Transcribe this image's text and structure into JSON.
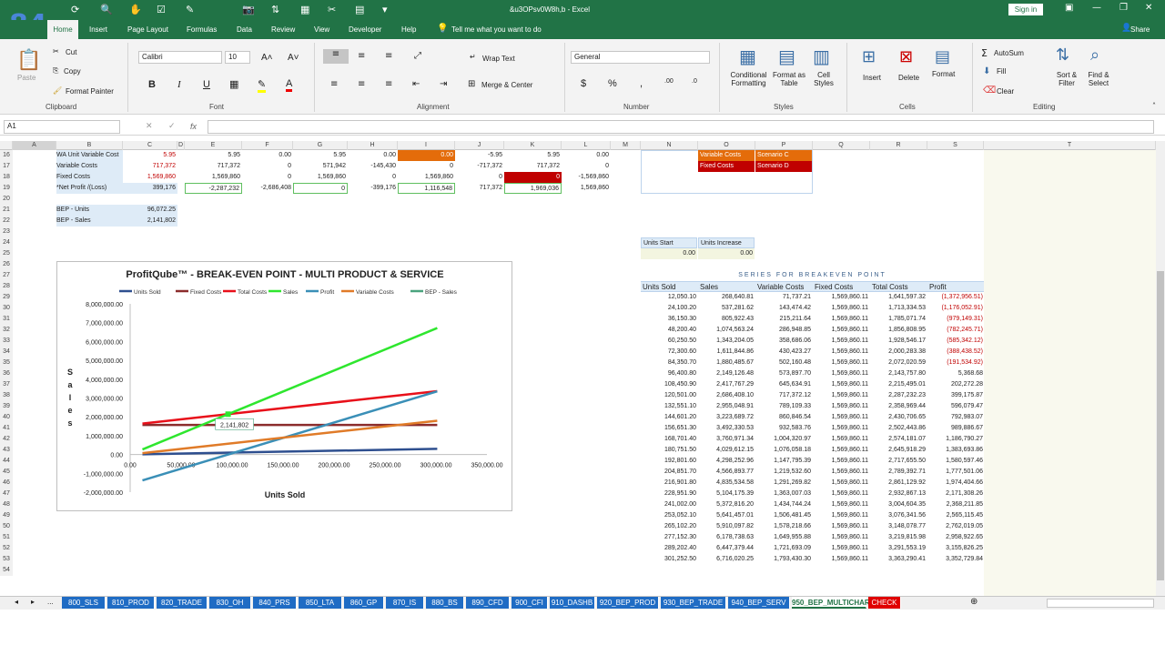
{
  "window": {
    "title": "&u3OPsv0W8h,b  -  Excel",
    "sign_in": "Sign in",
    "share": "Share",
    "logo": "84"
  },
  "tabs": [
    "Home",
    "Insert",
    "Page Layout",
    "Formulas",
    "Data",
    "Review",
    "View",
    "Developer",
    "Help"
  ],
  "tell_me": "Tell me what you want to do",
  "ribbon": {
    "paste": "Paste",
    "cut": "Cut",
    "copy": "Copy",
    "format_painter": "Format Painter",
    "clipboard": "Clipboard",
    "font_name": "Calibri",
    "font_size": "10",
    "font_group": "Font",
    "wrap_text": "Wrap Text",
    "merge_center": "Merge & Center",
    "alignment": "Alignment",
    "number_format": "General",
    "number_group": "Number",
    "cond_fmt": "Conditional Formatting",
    "format_table": "Format as Table",
    "cell_styles": "Cell Styles",
    "styles": "Styles",
    "insert": "Insert",
    "delete": "Delete",
    "format": "Format",
    "cells": "Cells",
    "autosum": "AutoSum",
    "fill": "Fill",
    "clear": "Clear",
    "sort_filter": "Sort & Filter",
    "find_select": "Find & Select",
    "editing": "Editing"
  },
  "name_box": "A1",
  "columns": [
    "A",
    "B",
    "C",
    "D",
    "E",
    "F",
    "G",
    "H",
    "I",
    "J",
    "K",
    "L",
    "M",
    "N",
    "O",
    "P",
    "Q",
    "R",
    "S",
    "T"
  ],
  "rows": [
    "16",
    "17",
    "18",
    "19",
    "20",
    "21",
    "22",
    "23",
    "24",
    "25",
    "26",
    "27",
    "28",
    "29",
    "30",
    "31",
    "32",
    "33",
    "34",
    "35",
    "36",
    "37",
    "38",
    "39",
    "40",
    "41",
    "42",
    "43",
    "44",
    "45",
    "46",
    "47",
    "48",
    "49",
    "50",
    "51",
    "52",
    "53",
    "54"
  ],
  "left_table": {
    "r16": {
      "label": "WA Unit Variable Cost",
      "c": "5.95",
      "e": "5.95",
      "f": "0.00",
      "g": "5.95",
      "h": "0.00",
      "i": "0.00",
      "j": "-5.95",
      "k": "5.95",
      "l": "0.00"
    },
    "r17": {
      "label": "Variable Costs",
      "c": "717,372",
      "e": "717,372",
      "f": "0",
      "g": "571,942",
      "h": "-145,430",
      "i": "0",
      "j": "-717,372",
      "k": "717,372",
      "l": "0"
    },
    "r18": {
      "label": "Fixed Costs",
      "c": "1,569,860",
      "e": "1,569,860",
      "f": "0",
      "g": "1,569,860",
      "h": "0",
      "i": "1,569,860",
      "j": "0",
      "k": "0",
      "l": "-1,569,860"
    },
    "r19": {
      "label": "*Net Profit /(Loss)",
      "c": "399,176",
      "e": "-2,287,232",
      "f": "-2,686,408",
      "g": "0",
      "h": "-399,176",
      "i": "1,116,548",
      "j": "717,372",
      "k": "1,969,036",
      "l": "1,569,860"
    },
    "bep_units_label": "BEP - Units",
    "bep_units": "96,072.25",
    "bep_sales_label": "BEP - Sales",
    "bep_sales": "2,141,802"
  },
  "scenarios": {
    "var_label": "Variable Costs",
    "var_value": "Scenario C",
    "fix_label": "Fixed Costs",
    "fix_value": "Scenario D"
  },
  "units_start": {
    "label1": "Units Start",
    "label2": "Units Increase",
    "value": "0.00",
    "value2": "0.00"
  },
  "series": {
    "title": "SERIES FOR BREAKEVEN POINT",
    "headers": [
      "Units Sold",
      "Sales",
      "Variable Costs",
      "Fixed Costs",
      "Total Costs",
      "Profit"
    ],
    "rows": [
      [
        "12,050.10",
        "268,640.81",
        "71,737.21",
        "1,569,860.11",
        "1,641,597.32",
        "(1,372,956.51)"
      ],
      [
        "24,100.20",
        "537,281.62",
        "143,474.42",
        "1,569,860.11",
        "1,713,334.53",
        "(1,176,052.91)"
      ],
      [
        "36,150.30",
        "805,922.43",
        "215,211.64",
        "1,569,860.11",
        "1,785,071.74",
        "(979,149.31)"
      ],
      [
        "48,200.40",
        "1,074,563.24",
        "286,948.85",
        "1,569,860.11",
        "1,856,808.95",
        "(782,245.71)"
      ],
      [
        "60,250.50",
        "1,343,204.05",
        "358,686.06",
        "1,569,860.11",
        "1,928,546.17",
        "(585,342.12)"
      ],
      [
        "72,300.60",
        "1,611,844.86",
        "430,423.27",
        "1,569,860.11",
        "2,000,283.38",
        "(388,438.52)"
      ],
      [
        "84,350.70",
        "1,880,485.67",
        "502,160.48",
        "1,569,860.11",
        "2,072,020.59",
        "(191,534.92)"
      ],
      [
        "96,400.80",
        "2,149,126.48",
        "573,897.70",
        "1,569,860.11",
        "2,143,757.80",
        "5,368.68"
      ],
      [
        "108,450.90",
        "2,417,767.29",
        "645,634.91",
        "1,569,860.11",
        "2,215,495.01",
        "202,272.28"
      ],
      [
        "120,501.00",
        "2,686,408.10",
        "717,372.12",
        "1,569,860.11",
        "2,287,232.23",
        "399,175.87"
      ],
      [
        "132,551.10",
        "2,955,048.91",
        "789,109.33",
        "1,569,860.11",
        "2,358,969.44",
        "596,079.47"
      ],
      [
        "144,601.20",
        "3,223,689.72",
        "860,846.54",
        "1,569,860.11",
        "2,430,706.65",
        "792,983.07"
      ],
      [
        "156,651.30",
        "3,492,330.53",
        "932,583.76",
        "1,569,860.11",
        "2,502,443.86",
        "989,886.67"
      ],
      [
        "168,701.40",
        "3,760,971.34",
        "1,004,320.97",
        "1,569,860.11",
        "2,574,181.07",
        "1,186,790.27"
      ],
      [
        "180,751.50",
        "4,029,612.15",
        "1,076,058.18",
        "1,569,860.11",
        "2,645,918.29",
        "1,383,693.86"
      ],
      [
        "192,801.60",
        "4,298,252.96",
        "1,147,795.39",
        "1,569,860.11",
        "2,717,655.50",
        "1,580,597.46"
      ],
      [
        "204,851.70",
        "4,566,893.77",
        "1,219,532.60",
        "1,569,860.11",
        "2,789,392.71",
        "1,777,501.06"
      ],
      [
        "216,901.80",
        "4,835,534.58",
        "1,291,269.82",
        "1,569,860.11",
        "2,861,129.92",
        "1,974,404.66"
      ],
      [
        "228,951.90",
        "5,104,175.39",
        "1,363,007.03",
        "1,569,860.11",
        "2,932,867.13",
        "2,171,308.26"
      ],
      [
        "241,002.00",
        "5,372,816.20",
        "1,434,744.24",
        "1,569,860.11",
        "3,004,604.35",
        "2,368,211.85"
      ],
      [
        "253,052.10",
        "5,641,457.01",
        "1,506,481.45",
        "1,569,860.11",
        "3,076,341.56",
        "2,565,115.45"
      ],
      [
        "265,102.20",
        "5,910,097.82",
        "1,578,218.66",
        "1,569,860.11",
        "3,148,078.77",
        "2,762,019.05"
      ],
      [
        "277,152.30",
        "6,178,738.63",
        "1,649,955.88",
        "1,569,860.11",
        "3,219,815.98",
        "2,958,922.65"
      ],
      [
        "289,202.40",
        "6,447,379.44",
        "1,721,693.09",
        "1,569,860.11",
        "3,291,553.19",
        "3,155,826.25"
      ],
      [
        "301,252.50",
        "6,716,020.25",
        "1,793,430.30",
        "1,569,860.11",
        "3,363,290.41",
        "3,352,729.84"
      ]
    ]
  },
  "chart_data": {
    "type": "line",
    "title": "ProfitQube™ - BREAK-EVEN POINT - MULTI PRODUCT & SERVICE",
    "xlabel": "Units Sold",
    "ylabel": "Sales",
    "xlim": [
      0,
      350000
    ],
    "ylim": [
      -2000000,
      8000000
    ],
    "x_ticks": [
      "0.00",
      "50,000.00",
      "100,000.00",
      "150,000.00",
      "200,000.00",
      "250,000.00",
      "300,000.00",
      "350,000.00"
    ],
    "y_ticks": [
      "8,000,000.00",
      "7,000,000.00",
      "6,000,000.00",
      "5,000,000.00",
      "4,000,000.00",
      "3,000,000.00",
      "2,000,000.00",
      "1,000,000.00",
      "0.00",
      "-1,000,000.00",
      "-2,000,000.00"
    ],
    "x": [
      12050,
      301252
    ],
    "series": [
      {
        "name": "Units Sold",
        "color": "#2e4f8f",
        "values": [
          12050,
          301252
        ]
      },
      {
        "name": "Fixed Costs",
        "color": "#8b2c2c",
        "values": [
          1569860,
          1569860
        ]
      },
      {
        "name": "Total Costs",
        "color": "#e8101a",
        "values": [
          1641597,
          3363290
        ]
      },
      {
        "name": "Sales",
        "color": "#2ee62e",
        "values": [
          268641,
          6716020
        ]
      },
      {
        "name": "Profit",
        "color": "#3a8fb7",
        "values": [
          -1372957,
          3352730
        ]
      },
      {
        "name": "Variable Costs",
        "color": "#e07b28",
        "values": [
          71737,
          1793430
        ]
      },
      {
        "name": "BEP - Sales",
        "color": "#4aa37e",
        "values": [
          null,
          null
        ]
      }
    ],
    "bep": {
      "x": 96072,
      "y": 2141802,
      "label": "2,141,802"
    }
  },
  "sheet_tabs": [
    "800_SLS",
    "810_PROD",
    "820_TRADE",
    "830_OH",
    "840_PRS",
    "850_LTA",
    "860_GP",
    "870_IS",
    "880_BS",
    "890_CFD",
    "900_CFI",
    "910_DASHB",
    "920_BEP_PROD",
    "930_BEP_TRADE",
    "940_BEP_SERV",
    "950_BEP_MULTICHART",
    "CHECK"
  ],
  "active_tab": "950_BEP_MULTICHART",
  "ellipsis": "..."
}
